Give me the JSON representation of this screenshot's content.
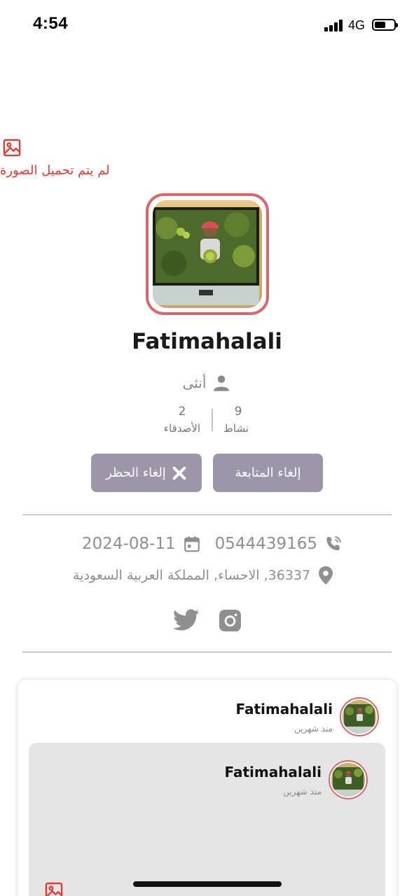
{
  "status_bar": {
    "time": "4:54",
    "network": "4G"
  },
  "cover": {
    "error_text": "لم يتم تحميل الصورة"
  },
  "profile": {
    "username": "Fatimahalali",
    "gender": "أنثى",
    "stats": {
      "activity_count": "9",
      "activity_label": "نشاط",
      "friends_count": "2",
      "friends_label": "الأصدقاء"
    }
  },
  "actions": {
    "unfollow_label": "إلغاء المتابعة",
    "unblock_label": "إلغاء الحظر"
  },
  "info": {
    "phone": "0544439165",
    "date": "2024-08-11",
    "location": "36337, الاحساء, المملكة العربية السعودية"
  },
  "social": {
    "icons": [
      "twitter-icon",
      "instagram-icon"
    ]
  },
  "feed": {
    "post": {
      "author": "Fatimahalali",
      "time": "منذ شهرين"
    },
    "shared_post": {
      "author": "Fatimahalali",
      "time": "منذ شهرين"
    }
  },
  "colors": {
    "accent_red": "#d9686e",
    "button_bg": "#9c96a9",
    "error_red": "#e53935",
    "muted_text": "#8f8f8f"
  }
}
